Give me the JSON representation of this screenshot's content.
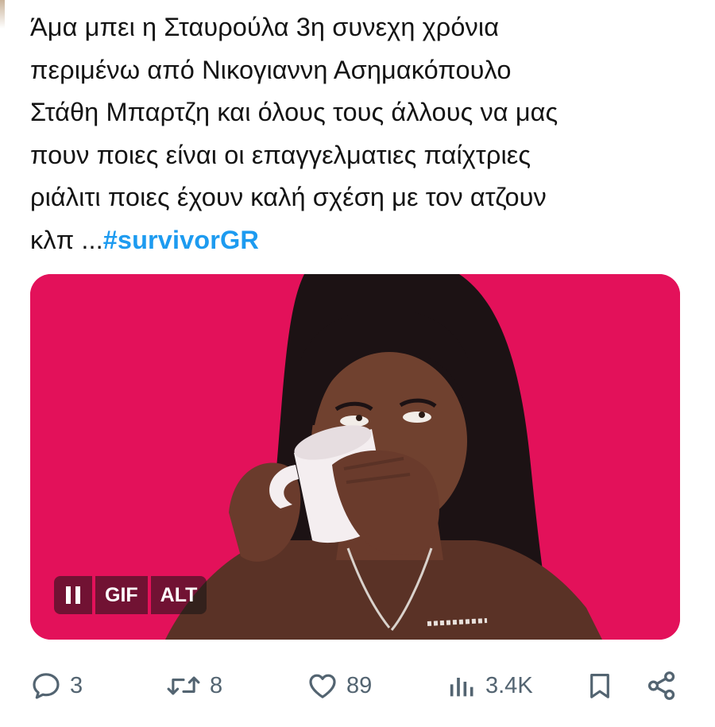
{
  "tweet": {
    "lines": [
      "Άμα μπει η Σταυρούλα 3η συνεχη χρόνια",
      "περιμένω από Νικογιαννη Ασημακόπουλο",
      "Στάθη Μπαρτζη και όλους τους άλλους να μας",
      "πουν ποιες είναι οι επαγγελματιες παίχτριες",
      "ριάλιτι ποιες έχουν καλή σχέση με τον ατζουν",
      "κλπ ..."
    ],
    "hashtag": "#survivorGR"
  },
  "media": {
    "type": "GIF",
    "background_color": "#e3115a",
    "controls": {
      "pause_icon": "pause-icon",
      "gif_label": "GIF",
      "alt_label": "ALT"
    }
  },
  "actions": {
    "reply": {
      "icon": "reply-bubble-icon",
      "count": "3"
    },
    "retweet": {
      "icon": "retweet-icon",
      "count": "8"
    },
    "like": {
      "icon": "heart-icon",
      "count": "89"
    },
    "views": {
      "icon": "views-bar-chart-icon",
      "count": "3.4K"
    },
    "bookmark": {
      "icon": "bookmark-icon"
    },
    "share": {
      "icon": "share-icon"
    }
  },
  "colors": {
    "hashtag": "#1d9bf0",
    "action_gray": "#536471",
    "text": "#141414"
  }
}
